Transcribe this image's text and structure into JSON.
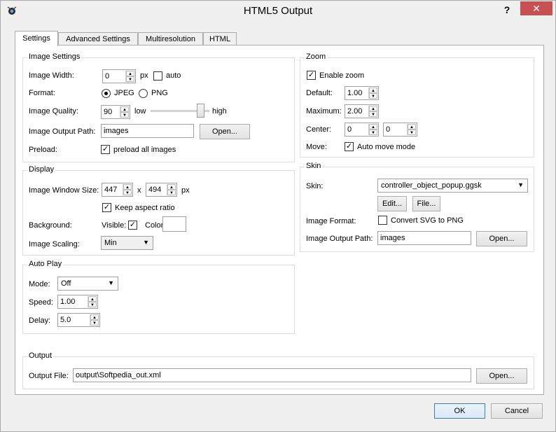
{
  "window": {
    "title": "HTML5 Output",
    "help_label": "?",
    "close_label": "✕"
  },
  "tabs": [
    "Settings",
    "Advanced Settings",
    "Multiresolution",
    "HTML"
  ],
  "image_settings": {
    "title": "Image Settings",
    "width_label": "Image Width:",
    "width_value": "0",
    "width_unit": "px",
    "auto_label": "auto",
    "format_label": "Format:",
    "format_jpeg": "JPEG",
    "format_png": "PNG",
    "quality_label": "Image Quality:",
    "quality_value": "90",
    "quality_low": "low",
    "quality_high": "high",
    "output_path_label": "Image Output Path:",
    "output_path_value": "images",
    "open_label": "Open...",
    "preload_label": "Preload:",
    "preload_checkbox_label": "preload all images"
  },
  "display": {
    "title": "Display",
    "window_size_label": "Image Window Size:",
    "width_value": "447",
    "x_label": "x",
    "height_value": "494",
    "unit": "px",
    "keep_aspect_label": "Keep aspect ratio",
    "background_label": "Background:",
    "visible_label": "Visible:",
    "color_label": "Color:",
    "scaling_label": "Image Scaling:",
    "scaling_value": "Min"
  },
  "autoplay": {
    "title": "Auto Play",
    "mode_label": "Mode:",
    "mode_value": "Off",
    "speed_label": "Speed:",
    "speed_value": "1.00",
    "delay_label": "Delay:",
    "delay_value": "5.0"
  },
  "zoom": {
    "title": "Zoom",
    "enable_label": "Enable zoom",
    "default_label": "Default:",
    "default_value": "1.00",
    "maximum_label": "Maximum:",
    "maximum_value": "2.00",
    "center_label": "Center:",
    "center_x": "0",
    "center_y": "0",
    "move_label": "Move:",
    "auto_move_label": "Auto move mode"
  },
  "skin": {
    "title": "Skin",
    "skin_label": "Skin:",
    "skin_value": "controller_object_popup.ggsk",
    "edit_label": "Edit...",
    "file_label": "File...",
    "image_format_label": "Image Format:",
    "convert_label": "Convert SVG to PNG",
    "output_path_label": "Image Output Path:",
    "output_path_value": "images",
    "open_label": "Open..."
  },
  "output": {
    "title": "Output",
    "file_label": "Output File:",
    "file_value": "output\\Softpedia_out.xml",
    "open_label": "Open..."
  },
  "footer": {
    "ok_label": "OK",
    "cancel_label": "Cancel"
  },
  "colors": {
    "close_button": "#c75050",
    "default_button_border": "#3c7fb1"
  },
  "icons": {
    "app": "app-icon",
    "up": "▲",
    "down": "▼",
    "caret": "▼",
    "check": "✓"
  }
}
